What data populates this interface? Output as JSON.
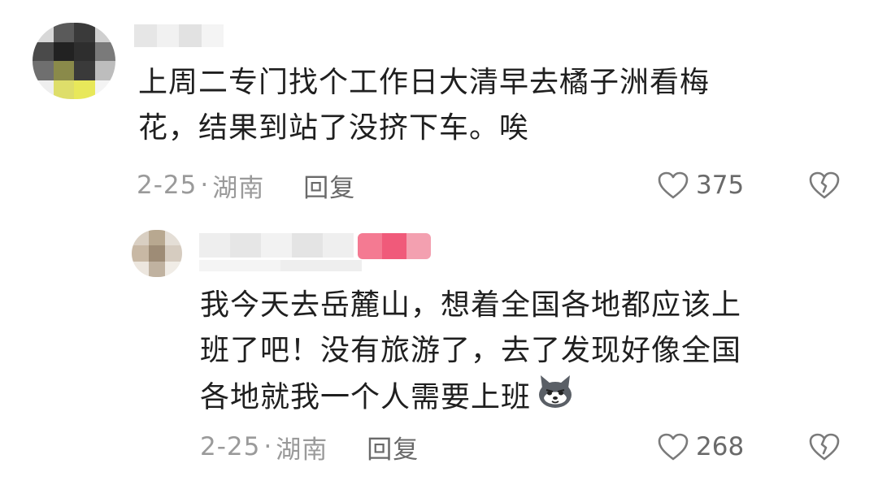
{
  "comments": [
    {
      "text_line1": "上周二专门找个工作日大清早去橘子洲看梅",
      "text_line2": "花，结果到站了没挤下车。唉",
      "date": "2-25",
      "separator": "·",
      "location": "湖南",
      "reply_label": "回复",
      "likes": "375"
    },
    {
      "text_line1": "我今天去岳麓山，想着全国各地都应该上",
      "text_line2": "班了吧！没有旅游了，去了发现好像全国",
      "text_line3": "各地就我一个人需要上班",
      "date": "2-25",
      "separator": "·",
      "location": "湖南",
      "reply_label": "回复",
      "likes": "268"
    }
  ],
  "icons": {
    "like": "heart-outline-icon",
    "dislike": "broken-heart-icon",
    "emoji": "dog-face-emoji-icon"
  },
  "colors": {
    "text": "#1f1f1f",
    "meta": "#9a9a9a",
    "secondary": "#6a6a6a",
    "pink_blur": "#f05a7a"
  }
}
